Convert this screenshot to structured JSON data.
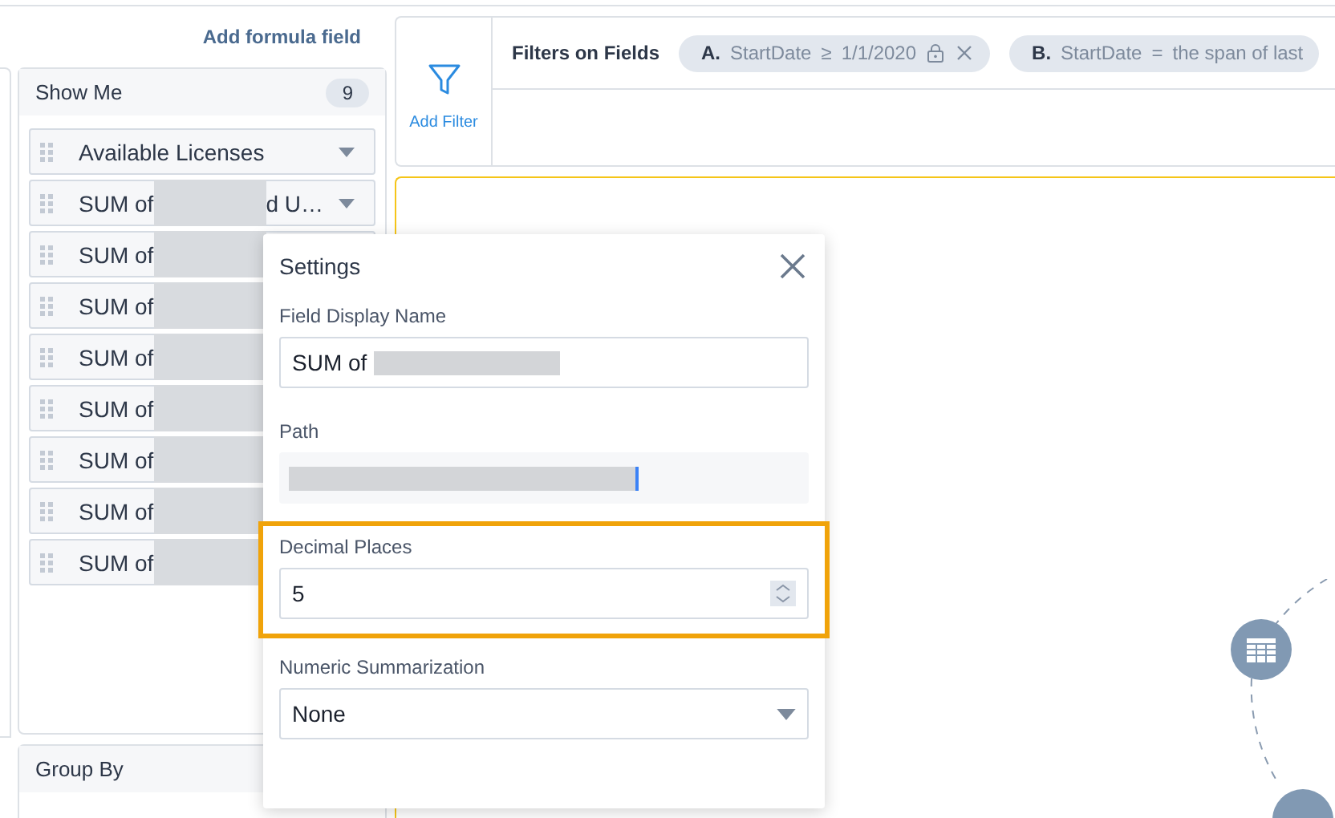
{
  "header": {
    "add_formula_link": "Add formula field"
  },
  "show_me": {
    "title": "Show Me",
    "count": "9",
    "fields": [
      {
        "kind": "plain",
        "label": "Available Licenses"
      },
      {
        "kind": "redacted",
        "label": "SUM of",
        "suffix": "d U…"
      },
      {
        "kind": "redacted",
        "label": "SUM of"
      },
      {
        "kind": "redacted",
        "label": "SUM of"
      },
      {
        "kind": "redacted",
        "label": "SUM of"
      },
      {
        "kind": "redacted",
        "label": "SUM of"
      },
      {
        "kind": "redacted",
        "label": "SUM of"
      },
      {
        "kind": "redacted",
        "label": "SUM of"
      },
      {
        "kind": "redacted",
        "label": "SUM of"
      }
    ]
  },
  "group_by": {
    "title": "Group By"
  },
  "filters": {
    "add_filter": "Add Filter",
    "title": "Filters on Fields",
    "chips": [
      {
        "letter": "A.",
        "field": "StartDate",
        "operator": "≥",
        "value": "1/1/2020",
        "locked": true,
        "removable": true
      },
      {
        "letter": "B.",
        "field": "StartDate",
        "operator": "=",
        "value": "the span of last",
        "locked": false,
        "removable": false
      }
    ]
  },
  "settings": {
    "title": "Settings",
    "fields": [
      {
        "kind": "text",
        "label": "Field Display Name",
        "value": "SUM of",
        "redacted": true,
        "highlighted": false
      },
      {
        "kind": "readonly",
        "label": "Path",
        "redacted": true,
        "highlighted": false
      },
      {
        "kind": "number",
        "label": "Decimal Places",
        "value": "5",
        "redacted": false,
        "highlighted": true
      },
      {
        "kind": "select",
        "label": "Numeric Summarization",
        "value": "None",
        "redacted": false,
        "highlighted": false
      }
    ]
  }
}
